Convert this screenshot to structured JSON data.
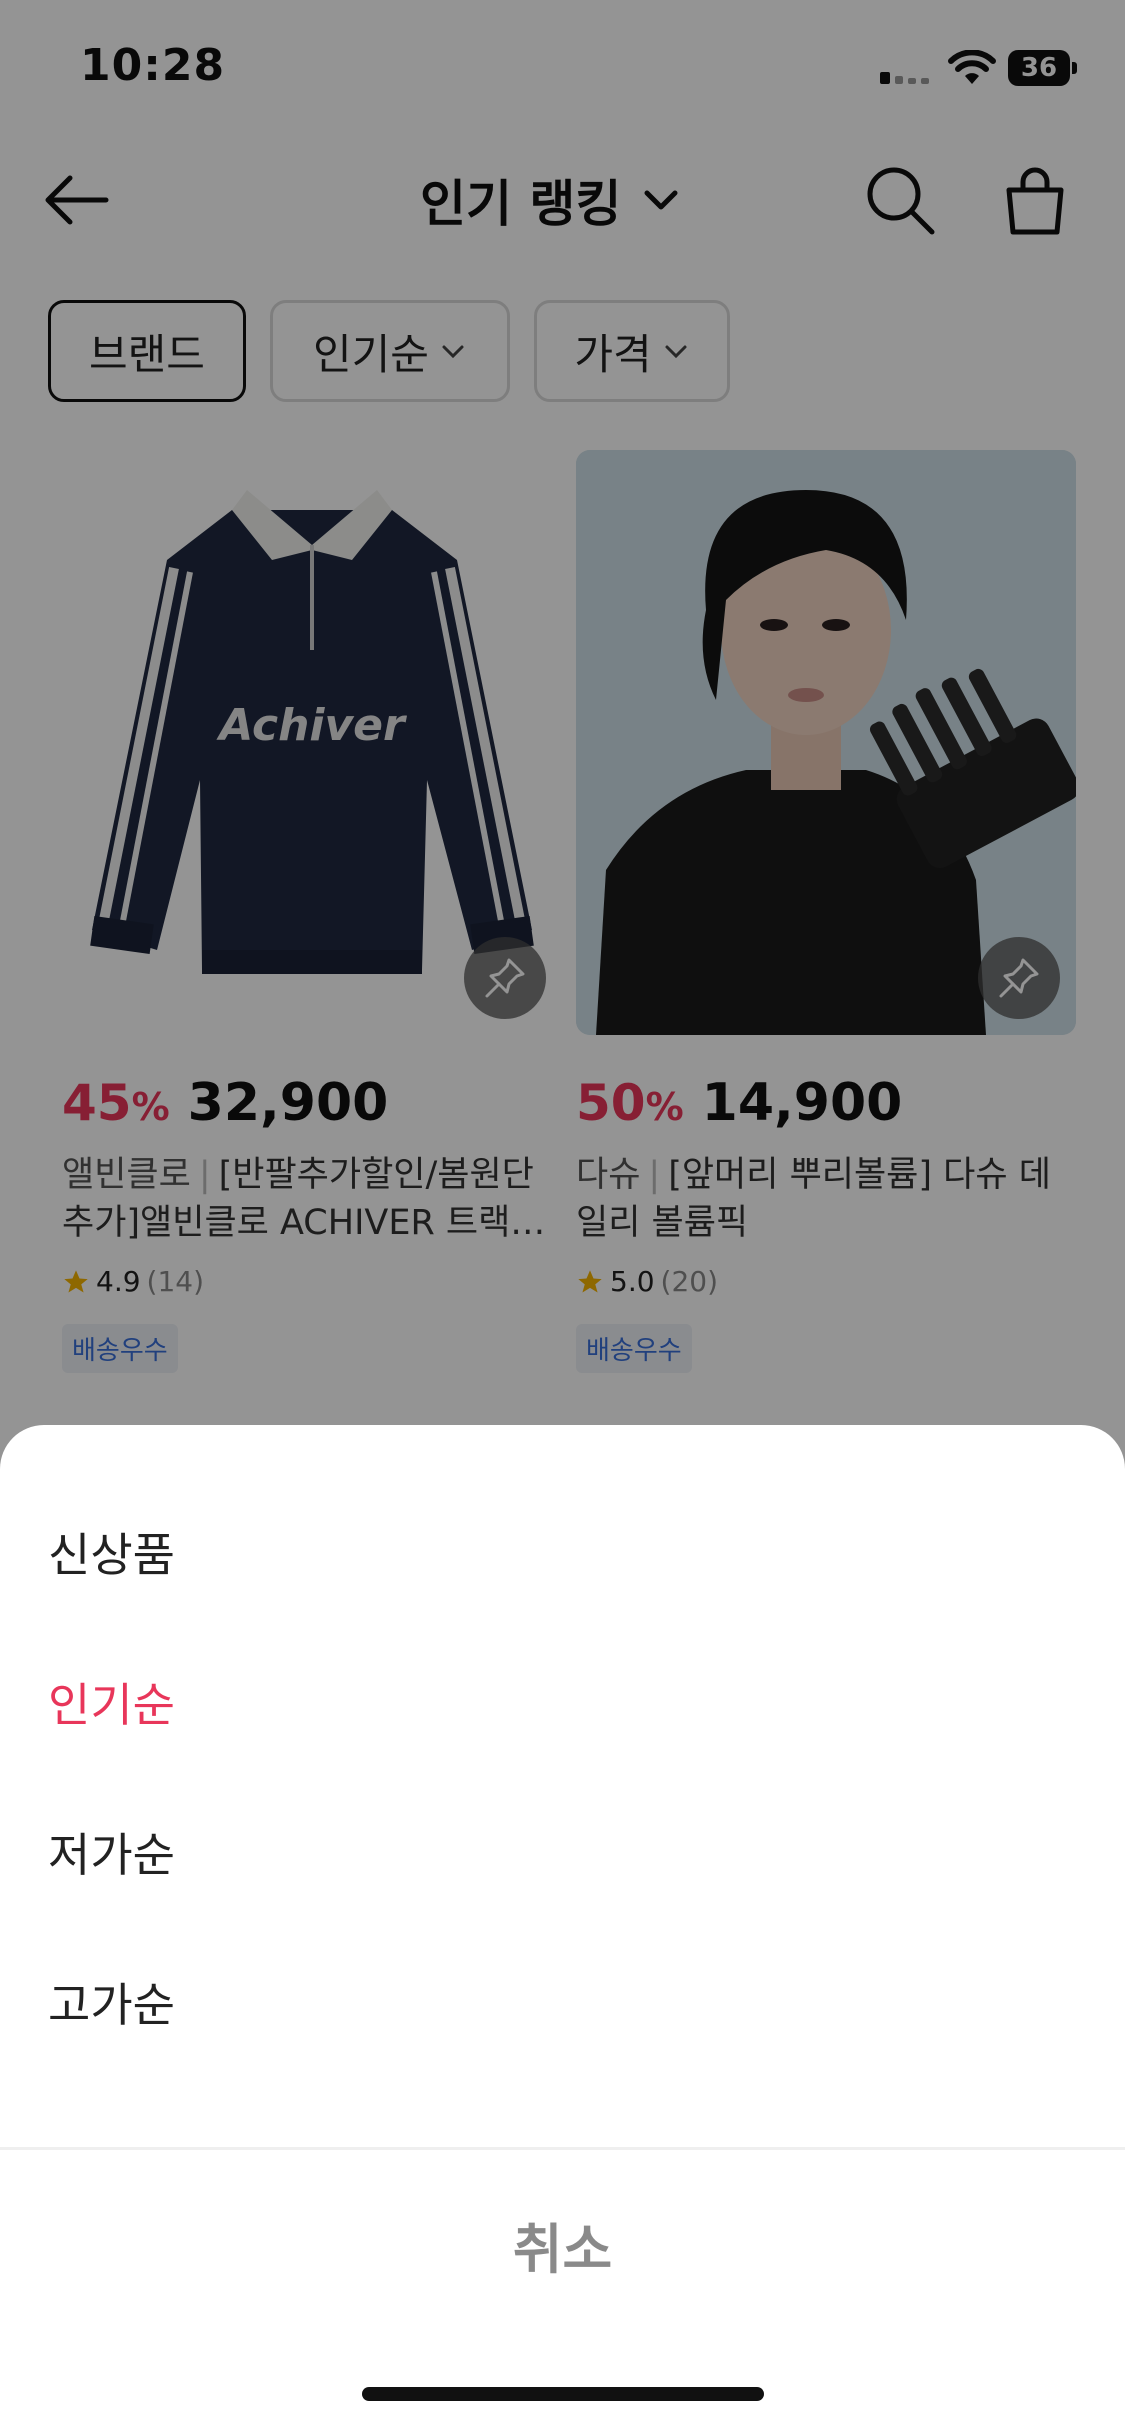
{
  "status_bar": {
    "time": "10:28",
    "battery": "36"
  },
  "header": {
    "title": "인기 랭킹"
  },
  "filters": {
    "brand": "브랜드",
    "sort": "인기순",
    "price": "가격"
  },
  "products": [
    {
      "discount": "45",
      "discount_unit": "%",
      "price": "32,900",
      "brand": "앨빈클로",
      "name": "[반팔추가할인/봄원단추가]앨빈클로 ACHIVER 트랙…",
      "rating": "4.9",
      "reviews": "(14)",
      "badge": "배송우수",
      "image_text": "Achiver"
    },
    {
      "discount": "50",
      "discount_unit": "%",
      "price": "14,900",
      "brand": "다슈",
      "name": "[앞머리 뿌리볼륨] 다슈 데일리 볼륨픽",
      "rating": "5.0",
      "reviews": "(20)",
      "badge": "배송우수"
    }
  ],
  "sort_sheet": {
    "options": [
      "신상품",
      "인기순",
      "저가순",
      "고가순"
    ],
    "selected": "인기순",
    "cancel": "취소"
  },
  "colors": {
    "accent": "#e8365a",
    "badge_text": "#3a6fd8",
    "dim": "rgba(0,0,0,0.42)"
  }
}
